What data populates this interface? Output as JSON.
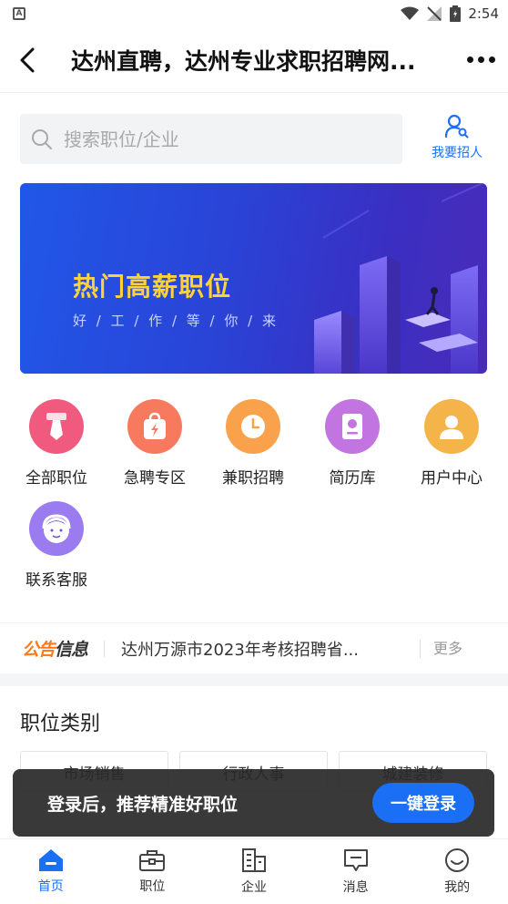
{
  "status_bar": {
    "left_icon": "a-icon",
    "time": "2:54"
  },
  "header": {
    "title": "达州直聘，达州专业求职招聘网...",
    "back_icon": "chevron-left-icon",
    "more_icon": "more-dots-icon"
  },
  "search": {
    "placeholder": "搜索职位/企业",
    "recruit_label": "我要招人"
  },
  "banner": {
    "title": "热门高薪职位",
    "subtitle": "好 / 工 / 作 / 等 / 你 / 来"
  },
  "features": [
    {
      "label": "全部职位",
      "icon": "tie-icon",
      "color": "#f05a7e"
    },
    {
      "label": "急聘专区",
      "icon": "bag-lightning-icon",
      "color": "#f77a5e"
    },
    {
      "label": "兼职招聘",
      "icon": "clock-icon",
      "color": "#f9a24b"
    },
    {
      "label": "简历库",
      "icon": "resume-icon",
      "color": "#c274e0"
    },
    {
      "label": "用户中心",
      "icon": "user-icon",
      "color": "#f5b44a"
    },
    {
      "label": "联系客服",
      "icon": "customer-service-icon",
      "color": "#9a7cf0"
    }
  ],
  "notice": {
    "logo_part1": "公告",
    "logo_part2": "信息",
    "text": "达州万源市2023年考核招聘省...",
    "more": "更多"
  },
  "categories": {
    "title": "职位类别",
    "items": [
      "市场销售",
      "行政人事",
      "城建装修"
    ]
  },
  "login_prompt": {
    "text": "登录后，推荐精准好职位",
    "button": "一键登录"
  },
  "bottom_nav": [
    {
      "label": "首页",
      "icon": "home-icon",
      "active": true
    },
    {
      "label": "职位",
      "icon": "briefcase-icon",
      "active": false
    },
    {
      "label": "企业",
      "icon": "building-icon",
      "active": false
    },
    {
      "label": "消息",
      "icon": "message-icon",
      "active": false
    },
    {
      "label": "我的",
      "icon": "profile-icon",
      "active": false
    }
  ],
  "colors": {
    "accent": "#1a6ff5",
    "banner_title": "#ffd23a"
  }
}
